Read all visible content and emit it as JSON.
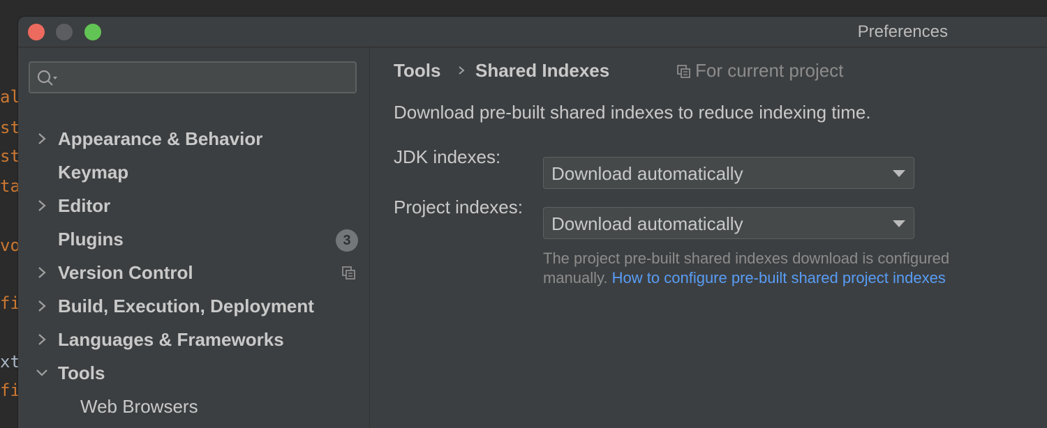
{
  "editor_fragments": [
    "al",
    "st",
    "st",
    "ta",
    "vo",
    "fi",
    "xt",
    "fi"
  ],
  "window": {
    "title": "Preferences"
  },
  "search": {
    "placeholder": "",
    "value": ""
  },
  "sidebar": {
    "items": [
      {
        "label": "Appearance & Behavior",
        "expandable": true,
        "expanded": false
      },
      {
        "label": "Keymap",
        "expandable": false
      },
      {
        "label": "Editor",
        "expandable": true,
        "expanded": false
      },
      {
        "label": "Plugins",
        "expandable": false,
        "badge": "3"
      },
      {
        "label": "Version Control",
        "expandable": true,
        "expanded": false,
        "icon": "project-scope-icon"
      },
      {
        "label": "Build, Execution, Deployment",
        "expandable": true,
        "expanded": false
      },
      {
        "label": "Languages & Frameworks",
        "expandable": true,
        "expanded": false
      },
      {
        "label": "Tools",
        "expandable": true,
        "expanded": true
      },
      {
        "label": "Web Browsers",
        "expandable": false,
        "child": true
      }
    ]
  },
  "content": {
    "breadcrumb": {
      "parent": "Tools",
      "current": "Shared Indexes"
    },
    "scope_label": "For current project",
    "description": "Download pre-built shared indexes to reduce indexing time.",
    "jdk": {
      "label": "JDK indexes:",
      "value": "Download automatically"
    },
    "project": {
      "label": "Project indexes:",
      "value": "Download automatically"
    },
    "hint": {
      "text": "The project pre-built shared indexes download is configured manually.",
      "link": "How to configure pre-built shared project indexes"
    }
  },
  "colors": {
    "background": "#3c3f41",
    "text": "#c9c9c9",
    "link": "#589df6",
    "close": "#ed6a5e",
    "maximize": "#62c454"
  }
}
